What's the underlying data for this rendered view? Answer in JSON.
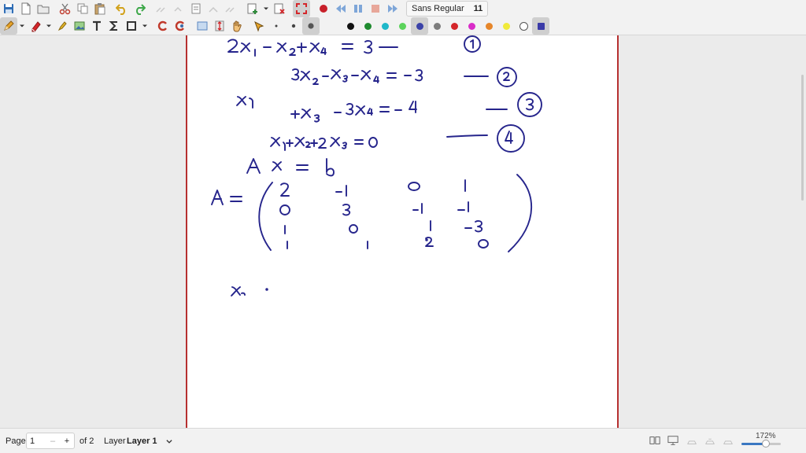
{
  "toolbar": {
    "font_name": "Sans Regular",
    "font_size": "11",
    "palette": [
      "#111111",
      "#1e8a2e",
      "#1fb8c9",
      "#5bd35b",
      "#3b42a8",
      "#7d7d7d",
      "#d4262a",
      "#d92cc8",
      "#e6862a",
      "#f0ea3a",
      "#ffffff",
      "#3b3ba8"
    ]
  },
  "status": {
    "page_label": "Page",
    "page_value": "1",
    "page_minus": "–",
    "page_plus": "+",
    "page_of": "of 2",
    "layer_label": "Layer",
    "layer_value": "Layer 1",
    "zoom": "172%",
    "zoom_fraction": 0.62
  },
  "ink_color": "#26258c",
  "accent_border": "#b63030"
}
